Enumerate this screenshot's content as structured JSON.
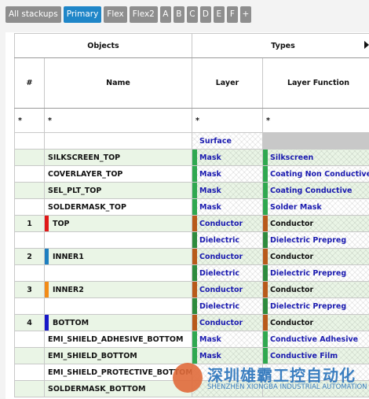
{
  "tabs": [
    {
      "label": "All stackups",
      "active": false
    },
    {
      "label": "Primary",
      "active": true
    },
    {
      "label": "Flex",
      "active": false
    },
    {
      "label": "Flex2",
      "active": false
    },
    {
      "label": "A",
      "active": false
    },
    {
      "label": "B",
      "active": false
    },
    {
      "label": "C",
      "active": false
    },
    {
      "label": "D",
      "active": false
    },
    {
      "label": "E",
      "active": false
    },
    {
      "label": "F",
      "active": false
    },
    {
      "label": "+",
      "active": false
    }
  ],
  "header": {
    "objects": "Objects",
    "types": "Types",
    "num": "#",
    "name": "Name",
    "layer": "Layer",
    "layer_function": "Layer Function"
  },
  "filter": {
    "num": "*",
    "name": "*",
    "layer": "*",
    "layer_function": "*"
  },
  "colors": {
    "mask_green": "#2fa84f",
    "conductor_brown": "#b85a1a",
    "dielectric_green": "#2e8b3d",
    "text_blue": "#1b1bb0"
  },
  "rows": [
    {
      "num": "",
      "name": "",
      "num_color": "",
      "layer": "Surface",
      "layer_color": "",
      "layer_text": "blue",
      "func": "",
      "func_color": "",
      "func_grey": true,
      "green": false
    },
    {
      "num": "",
      "name": "SILKSCREEN_TOP",
      "num_color": "",
      "layer": "Mask",
      "layer_color": "#2fa84f",
      "layer_text": "blue",
      "func": "Silkscreen",
      "func_color": "#2fa84f",
      "func_text": "blue",
      "green": true
    },
    {
      "num": "",
      "name": "COVERLAYER_TOP",
      "num_color": "",
      "layer": "Mask",
      "layer_color": "#2fa84f",
      "layer_text": "blue",
      "func": "Coating Non Conductive",
      "func_color": "#2fa84f",
      "func_text": "blue",
      "green": false
    },
    {
      "num": "",
      "name": "SEL_PLT_TOP",
      "num_color": "",
      "layer": "Mask",
      "layer_color": "#2fa84f",
      "layer_text": "blue",
      "func": "Coating Conductive",
      "func_color": "#2fa84f",
      "func_text": "blue",
      "green": true
    },
    {
      "num": "",
      "name": "SOLDERMASK_TOP",
      "num_color": "",
      "layer": "Mask",
      "layer_color": "#2fa84f",
      "layer_text": "blue",
      "func": "Solder Mask",
      "func_color": "#2fa84f",
      "func_text": "blue",
      "green": false
    },
    {
      "num": "1",
      "name": "TOP",
      "num_color": "#e01818",
      "layer": "Conductor",
      "layer_color": "#b85a1a",
      "layer_text": "blue",
      "func": "Conductor",
      "func_color": "#b85a1a",
      "func_text": "black",
      "green": true
    },
    {
      "num": "",
      "name": "",
      "num_color": "",
      "layer": "Dielectric",
      "layer_color": "#2e8b3d",
      "layer_text": "blue",
      "func": "Dielectric Prepreg",
      "func_color": "#2e8b3d",
      "func_text": "blue",
      "green": false
    },
    {
      "num": "2",
      "name": "INNER1",
      "num_color": "#1e7fc0",
      "layer": "Conductor",
      "layer_color": "#b85a1a",
      "layer_text": "blue",
      "func": "Conductor",
      "func_color": "#b85a1a",
      "func_text": "black",
      "green": true
    },
    {
      "num": "",
      "name": "",
      "num_color": "",
      "layer": "Dielectric",
      "layer_color": "#2e8b3d",
      "layer_text": "blue",
      "func": "Dielectric Prepreg",
      "func_color": "#2e8b3d",
      "func_text": "blue",
      "green": false
    },
    {
      "num": "3",
      "name": "INNER2",
      "num_color": "#f28c18",
      "layer": "Conductor",
      "layer_color": "#b85a1a",
      "layer_text": "blue",
      "func": "Conductor",
      "func_color": "#b85a1a",
      "func_text": "black",
      "green": true
    },
    {
      "num": "",
      "name": "",
      "num_color": "",
      "layer": "Dielectric",
      "layer_color": "#2e8b3d",
      "layer_text": "blue",
      "func": "Dielectric Prepreg",
      "func_color": "#2e8b3d",
      "func_text": "blue",
      "green": false
    },
    {
      "num": "4",
      "name": "BOTTOM",
      "num_color": "#1818c8",
      "layer": "Conductor",
      "layer_color": "#b85a1a",
      "layer_text": "blue",
      "func": "Conductor",
      "func_color": "#b85a1a",
      "func_text": "black",
      "green": true
    },
    {
      "num": "",
      "name": "EMI_SHIELD_ADHESIVE_BOTTOM",
      "num_color": "",
      "layer": "Mask",
      "layer_color": "#2fa84f",
      "layer_text": "blue",
      "func": "Conductive Adhesive",
      "func_color": "#2fa84f",
      "func_text": "blue",
      "green": false
    },
    {
      "num": "",
      "name": "EMI_SHIELD_BOTTOM",
      "num_color": "",
      "layer": "Mask",
      "layer_color": "#2fa84f",
      "layer_text": "blue",
      "func": "Conductive Film",
      "func_color": "#2fa84f",
      "func_text": "blue",
      "green": true
    },
    {
      "num": "",
      "name": "EMI_SHIELD_PROTECTIVE_BOTTOM",
      "num_color": "",
      "layer": "",
      "layer_color": "",
      "layer_text": "blue",
      "func": "",
      "func_color": "",
      "func_text": "blue",
      "green": false
    },
    {
      "num": "",
      "name": "SOLDERMASK_BOTTOM",
      "num_color": "",
      "layer": "",
      "layer_color": "",
      "layer_text": "blue",
      "func": "",
      "func_color": "",
      "func_text": "blue",
      "green": true
    }
  ],
  "watermark": {
    "title": "深圳雄霸工控自动化",
    "subtitle": "SHENZHEN XIONGBA INDUSTRIAL AUTOMATION"
  }
}
